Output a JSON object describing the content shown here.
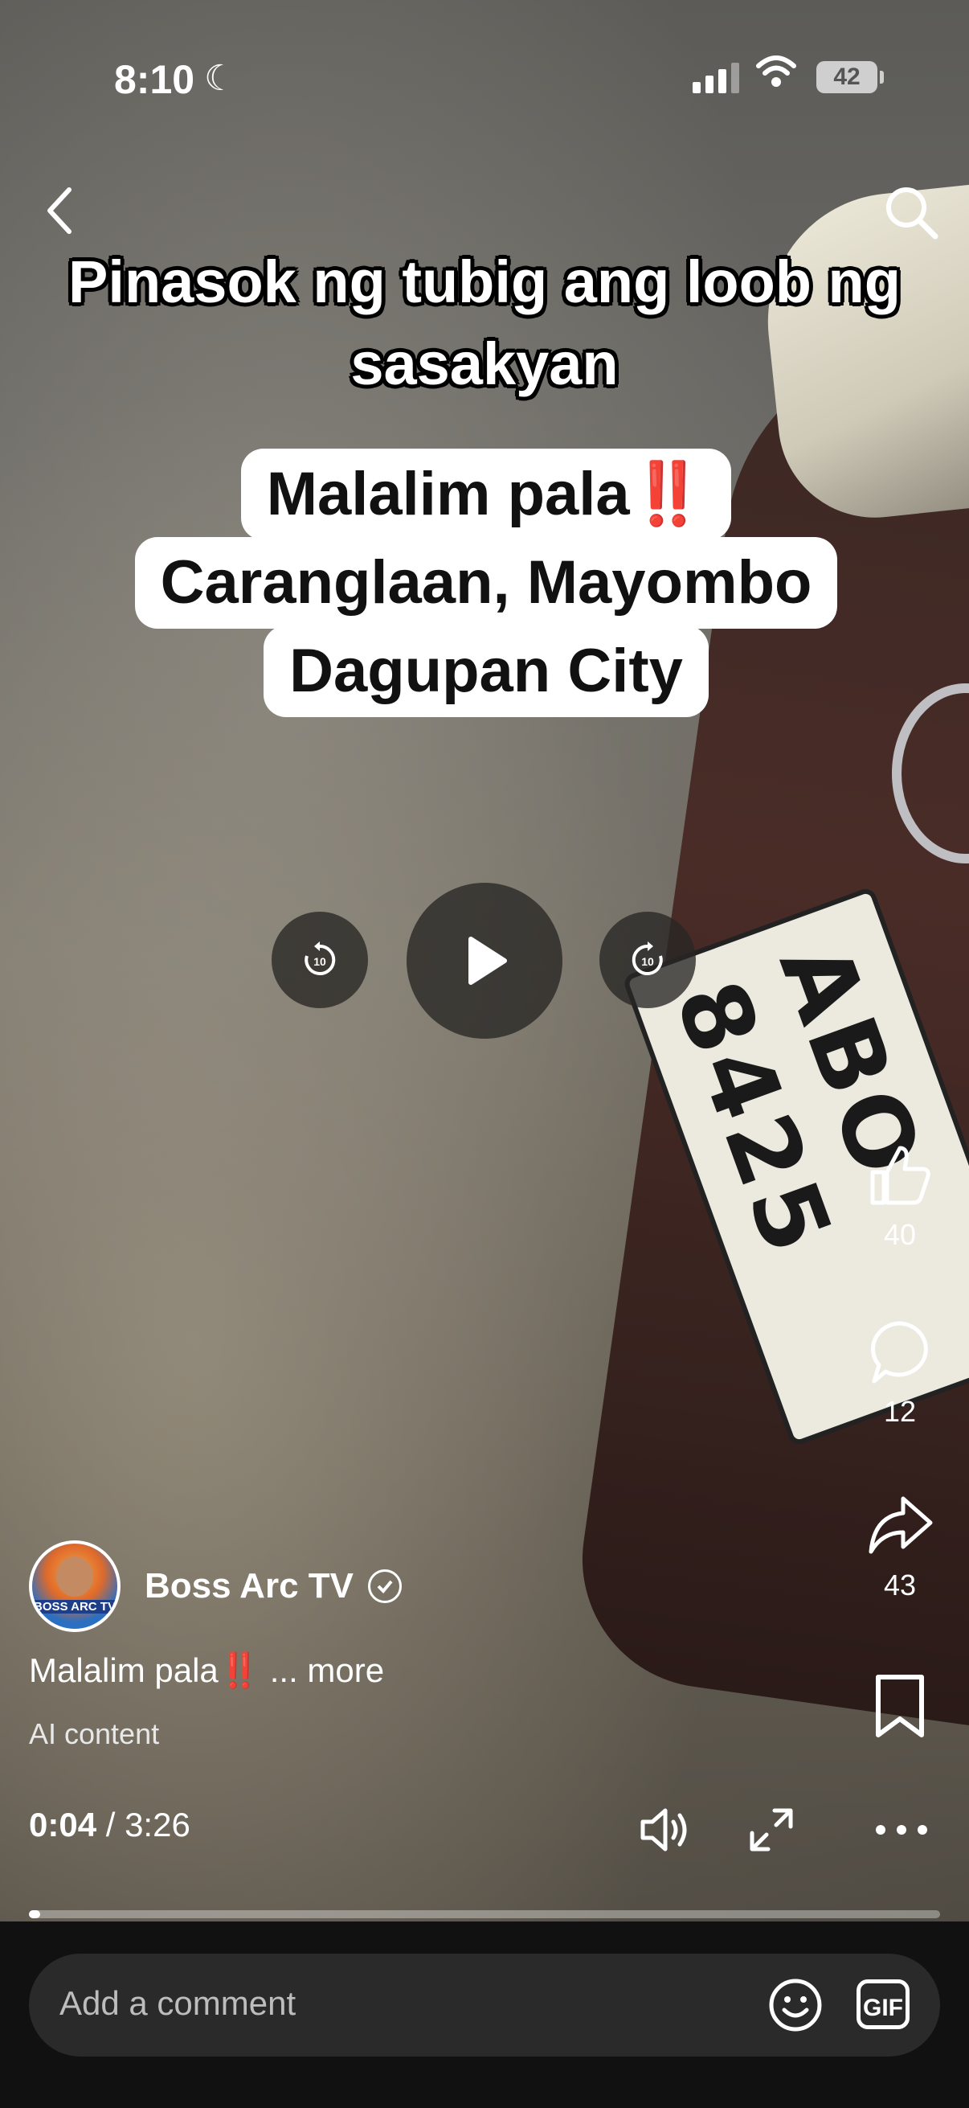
{
  "status_bar": {
    "time": "8:10",
    "battery": "42"
  },
  "video": {
    "headline_line1": "Pinasok ng tubig ang loob ng",
    "headline_line2": "sasakyan",
    "caption_line1": "Malalim pala",
    "caption_bang": "‼️",
    "caption_line2": "Caranglaan, Mayombo",
    "caption_line3": "Dagupan City",
    "plate_text": "ABO 8425"
  },
  "controls": {
    "rewind_label": "10",
    "forward_label": "10"
  },
  "actions": {
    "likes": "40",
    "comments": "12",
    "shares": "43"
  },
  "channel": {
    "name": "Boss Arc TV",
    "avatar_text": "BOSS ARC TV"
  },
  "description": {
    "text": "Malalim pala",
    "bang": "‼️",
    "more": " ... more"
  },
  "ai_label": "AI content",
  "player": {
    "current_time": "0:04",
    "separator": " / ",
    "duration": "3:26",
    "progress": 0.012
  },
  "comment_bar": {
    "placeholder": "Add a comment",
    "gif_label": "GIF"
  },
  "icons": [
    "back-icon",
    "search-icon",
    "rewind-10-icon",
    "play-icon",
    "forward-10-icon",
    "like-icon",
    "comment-icon",
    "share-icon",
    "bookmark-icon",
    "volume-icon",
    "fullscreen-icon",
    "more-icon",
    "emoji-icon",
    "gif-icon",
    "moon-icon",
    "signal-icon",
    "wifi-icon"
  ]
}
